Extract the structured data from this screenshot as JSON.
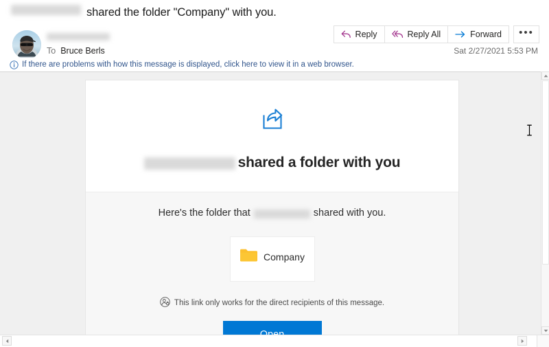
{
  "email": {
    "subject_redacted": true,
    "subject_text": "shared the folder \"Company\" with you.",
    "sender_name_redacted": true,
    "to_label": "To",
    "to_name": "Bruce Berls",
    "timestamp": "Sat 2/27/2021 5:53 PM",
    "avatar_icon": "person-photo-avatar"
  },
  "actions": {
    "reply": {
      "label": "Reply",
      "icon": "reply-arrow-icon",
      "color": "#a4388f"
    },
    "reply_all": {
      "label": "Reply All",
      "icon": "reply-all-arrow-icon",
      "color": "#a4388f"
    },
    "forward": {
      "label": "Forward",
      "icon": "forward-arrow-icon",
      "color": "#0078d4"
    },
    "more": {
      "label": "•••",
      "icon": "ellipsis-icon"
    }
  },
  "infobar": {
    "icon": "info-circle-icon",
    "text": "If there are problems with how this message is displayed, click here to view it in a web browser.",
    "link_color": "#31558c"
  },
  "card": {
    "share_icon": "share-arrow-out-of-box-icon",
    "share_icon_color": "#1a7fd4",
    "headline_name_redacted": true,
    "headline_text": "shared a folder with you",
    "subline_prefix": "Here's the folder that",
    "subline_name_redacted": true,
    "subline_suffix": "shared with you.",
    "folder": {
      "icon": "folder-icon",
      "icon_color": "#fcc02e",
      "name": "Company"
    },
    "notice": {
      "icon": "person-lock-circle-icon",
      "text": "This link only works for the direct recipients of this message."
    },
    "open_button": {
      "label": "Open",
      "color": "#0078d4"
    }
  },
  "scrollbars": {
    "vertical": {
      "up_icon": "scroll-up-arrow-icon",
      "down_icon": "scroll-down-arrow-icon"
    },
    "horizontal": {
      "left_icon": "scroll-left-arrow-icon",
      "right_icon": "scroll-right-arrow-icon"
    }
  },
  "cursor": {
    "icon": "text-ibeam-cursor"
  }
}
